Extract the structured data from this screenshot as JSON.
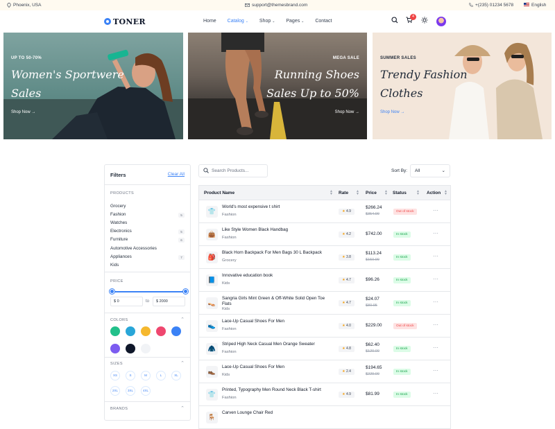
{
  "topbar": {
    "location": "Phoenix, USA",
    "email": "support@themesbrand.com",
    "phone": "+(235) 01234 5678",
    "language": "English"
  },
  "navbar": {
    "brand": "TONER",
    "menu": [
      {
        "label": "Home",
        "active": false,
        "has_dropdown": false
      },
      {
        "label": "Catalog",
        "active": true,
        "has_dropdown": true
      },
      {
        "label": "Shop",
        "active": false,
        "has_dropdown": true
      },
      {
        "label": "Pages",
        "active": false,
        "has_dropdown": true
      },
      {
        "label": "Contact",
        "active": false,
        "has_dropdown": false
      }
    ],
    "cart_count": "4",
    "icons": [
      "search-icon",
      "cart-icon",
      "theme-toggle-icon",
      "user-avatar"
    ]
  },
  "banners": [
    {
      "tag": "UP TO 50-70%",
      "title_line1": "Women's Sportwere",
      "title_line2": "Sales",
      "link": "Shop Now"
    },
    {
      "tag": "MEGA SALE",
      "title_line1": "Running Shoes",
      "title_line2": "Sales Up to 50%",
      "link": "Shop Now"
    },
    {
      "tag": "SUMMER SALES",
      "title_line1": "Trendy Fashion",
      "title_line2": "Clothes",
      "link": "Shop Now"
    }
  ],
  "filters": {
    "title": "Filters",
    "clear_label": "Clear All",
    "products_label": "PRODUCTS",
    "categories": [
      {
        "name": "Grocery",
        "count": ""
      },
      {
        "name": "Fashion",
        "count": "5"
      },
      {
        "name": "Watches",
        "count": ""
      },
      {
        "name": "Electronics",
        "count": "5"
      },
      {
        "name": "Furniture",
        "count": "6"
      },
      {
        "name": "Automotive Accessories",
        "count": ""
      },
      {
        "name": "Appliances",
        "count": "7"
      },
      {
        "name": "Kids",
        "count": ""
      }
    ],
    "price_label": "PRICE",
    "price_min": "$ 0",
    "price_max": "$ 2000",
    "price_to": "to",
    "colors_label": "COLORS",
    "colors": [
      "#22c08a",
      "#29a6d8",
      "#f5b82e",
      "#ef476f",
      "#3b82f6",
      "#7c5cf0",
      "#0f172a",
      "#f1f3f6"
    ],
    "sizes_label": "SIZES",
    "sizes": [
      "XS",
      "S",
      "M",
      "L",
      "XL",
      "2XL",
      "3XL",
      "4XL"
    ],
    "brands_label": "BRANDS"
  },
  "toolbar": {
    "search_placeholder": "Search Products...",
    "sort_label": "Sort By:",
    "sort_value": "All"
  },
  "table": {
    "headers": [
      "Product Name",
      "Rate",
      "Price",
      "Status",
      "Action"
    ],
    "rows": [
      {
        "name": "World's most expensive t shirt",
        "category": "Fashion",
        "rate": "4.9",
        "price": "$266.24",
        "old_price": "$354.99",
        "status": "Out of stock",
        "icon": "👕"
      },
      {
        "name": "Like Style Women Black Handbag",
        "category": "Fashion",
        "rate": "4.2",
        "price": "$742.00",
        "old_price": "",
        "status": "In stock",
        "icon": "👜"
      },
      {
        "name": "Black Horn Backpack For Men Bags 30 L Backpack",
        "category": "Grocery",
        "rate": "3.8",
        "price": "$113.24",
        "old_price": "$150.99",
        "status": "In stock",
        "icon": "🎒"
      },
      {
        "name": "Innovative education book",
        "category": "Kids",
        "rate": "4.7",
        "price": "$96.26",
        "old_price": "",
        "status": "In stock",
        "icon": "📘"
      },
      {
        "name": "Sangria Girls Mint Green & Off-White Solid Open Toe Flats",
        "category": "Kids",
        "rate": "4.7",
        "price": "$24.07",
        "old_price": "$80.95",
        "status": "In stock",
        "icon": "👡"
      },
      {
        "name": "Lace-Up Casual Shoes For Men",
        "category": "Fashion",
        "rate": "4.0",
        "price": "$229.00",
        "old_price": "",
        "status": "Out of stock",
        "icon": "👟"
      },
      {
        "name": "Striped High Neck Casual Men Orange Sweater",
        "category": "Fashion",
        "rate": "4.8",
        "price": "$62.40",
        "old_price": "$120.00",
        "status": "In stock",
        "icon": "🧥"
      },
      {
        "name": "Lace-Up Casual Shoes For Men",
        "category": "Kids",
        "rate": "2.4",
        "price": "$194.65",
        "old_price": "$229.00",
        "status": "In stock",
        "icon": "👞"
      },
      {
        "name": "Printed, Typography Men Round Neck Black T-shirt",
        "category": "Fashion",
        "rate": "4.9",
        "price": "$81.99",
        "old_price": "",
        "status": "In stock",
        "icon": "👕"
      },
      {
        "name": "Carven Lounge Chair Red",
        "category": "",
        "rate": "",
        "price": "",
        "old_price": "",
        "status": "",
        "icon": "🪑"
      }
    ]
  }
}
